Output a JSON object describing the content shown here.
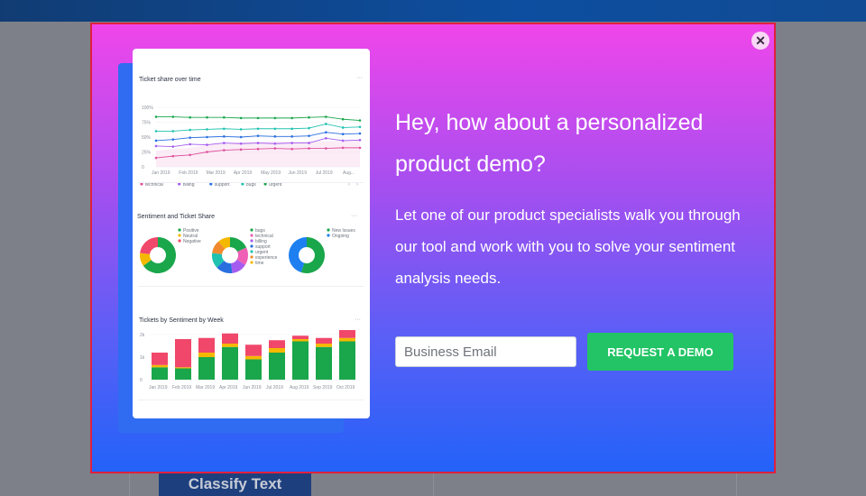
{
  "background": {
    "classify_button_label": "Classify Text"
  },
  "modal": {
    "close_icon": "✕",
    "headline": "Hey, how about a personalized product demo?",
    "body": "Let one of our product specialists walk you through our tool and work with you to solve your sentiment analysis needs.",
    "email_placeholder": "Business Email",
    "email_value": "",
    "cta_label": "REQUEST A DEMO",
    "colors": {
      "gradient_top": "#f046ea",
      "gradient_bottom": "#2362f8",
      "cta": "#22c465",
      "border": "#e0203f"
    }
  },
  "dashboard": {
    "more_icon": "···",
    "line_panel": {
      "title": "Ticket share over time",
      "chart_data": {
        "type": "line",
        "x": [
          "Jan 2019",
          "Feb 2019",
          "Mar 2019",
          "Apr 2019",
          "May 2019",
          "Jun 2019",
          "Jul 2019",
          "Aug..."
        ],
        "y_ticks": [
          "100%",
          "75%",
          "50%",
          "25%",
          "0"
        ],
        "ylim": [
          0,
          100
        ],
        "series": [
          {
            "name": "technical",
            "color": "#e0509d",
            "values": [
              15,
              18,
              20,
              25,
              28,
              29,
              30,
              31,
              30,
              31,
              31,
              32,
              32
            ]
          },
          {
            "name": "billing",
            "color": "#a45cf0",
            "values": [
              35,
              34,
              38,
              37,
              40,
              39,
              40,
              39,
              40,
              40,
              48,
              44,
              45
            ]
          },
          {
            "name": "support",
            "color": "#2a6fe0",
            "values": [
              44,
              46,
              49,
              50,
              51,
              50,
              52,
              51,
              51,
              52,
              58,
              55,
              56
            ]
          },
          {
            "name": "bugs",
            "color": "#20c2b0",
            "values": [
              60,
              60,
              62,
              63,
              64,
              63,
              64,
              64,
              64,
              65,
              72,
              66,
              67
            ]
          },
          {
            "name": "urgent",
            "color": "#1aa64b",
            "values": [
              84,
              84,
              83,
              83,
              83,
              82,
              82,
              82,
              82,
              83,
              84,
              80,
              78
            ]
          }
        ]
      }
    },
    "donut_panel": {
      "title": "Sentiment and Ticket Share",
      "chart_data": [
        {
          "type": "pie",
          "labels": [
            "Positive",
            "Neutral",
            "Negative"
          ],
          "values": [
            65,
            12,
            23
          ],
          "colors": [
            "#1aa64b",
            "#f5b800",
            "#f0476a"
          ]
        },
        {
          "type": "pie",
          "labels": [
            "bugs",
            "technical",
            "billing",
            "support",
            "urgent",
            "experience",
            "time"
          ],
          "values": [
            18,
            16,
            14,
            15,
            14,
            12,
            11
          ],
          "colors": [
            "#1aa64b",
            "#ef5fb5",
            "#a45cf0",
            "#2a6fe0",
            "#20c2b0",
            "#f08a2c",
            "#f5b800"
          ]
        },
        {
          "type": "pie",
          "labels": [
            "New Issues",
            "Ongoing"
          ],
          "values": [
            55,
            45
          ],
          "colors": [
            "#1aa64b",
            "#1e7ff0"
          ]
        }
      ]
    },
    "bar_panel": {
      "title": "Tickets by Sentiment by Week",
      "chart_data": {
        "type": "bar",
        "categories": [
          "Jan 2019",
          "Feb 2019",
          "Mar 2019",
          "Apr 2019",
          "Jun 2019",
          "Jul 2019",
          "Aug 2019",
          "Sep 2019",
          "Oct 2019"
        ],
        "y_ticks": [
          "2k",
          "1k",
          "0"
        ],
        "ylim": [
          0,
          2000
        ],
        "series": [
          {
            "name": "positive",
            "color": "#1aa64b",
            "values": [
              550,
              500,
              1000,
              1450,
              900,
              1200,
              1700,
              1450,
              1700
            ]
          },
          {
            "name": "neutral",
            "color": "#f5b800",
            "values": [
              100,
              50,
              200,
              150,
              150,
              200,
              100,
              150,
              150
            ]
          },
          {
            "name": "negative",
            "color": "#f0476a",
            "values": [
              550,
              1250,
              650,
              450,
              500,
              350,
              150,
              250,
              350
            ]
          }
        ]
      }
    }
  }
}
